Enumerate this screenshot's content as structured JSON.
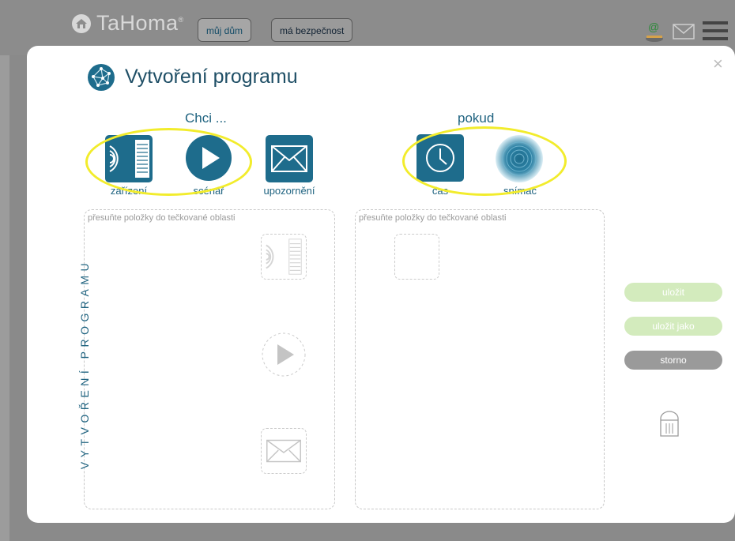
{
  "app": {
    "logo": "TaHoma",
    "logo_reg": "®"
  },
  "nav": {
    "tabs": [
      {
        "label": "můj dům",
        "active": true
      },
      {
        "label": "má bezpečnost",
        "active": false
      }
    ],
    "icons": [
      "user-email-icon",
      "envelope-icon",
      "hamburger-menu-icon"
    ]
  },
  "dialog": {
    "title": "Vytvoření programu",
    "close": "×",
    "vertical_label": "VYTVOŘENÍ PROGRAMU",
    "want_section": {
      "label": "Chci ...",
      "items": [
        {
          "label": "zařízení",
          "icon": "device-icon"
        },
        {
          "label": "scénář",
          "icon": "play-icon"
        },
        {
          "label": "upozornění",
          "icon": "envelope-icon"
        }
      ]
    },
    "if_section": {
      "label": "pokud",
      "items": [
        {
          "label": "čas",
          "icon": "clock-icon"
        },
        {
          "label": "snímač",
          "icon": "sensor-icon"
        }
      ]
    },
    "dropzone_hint": "přesuňte položky do tečkované oblasti",
    "buttons": {
      "save": "uložit",
      "save_as": "uložit jako",
      "cancel": "storno"
    },
    "colors": {
      "accent": "#1f6380",
      "tile": "#1e6c8c",
      "highlight": "#f2ec2c",
      "save": "#d3ebbd",
      "cancel": "#9a9a9a"
    }
  }
}
